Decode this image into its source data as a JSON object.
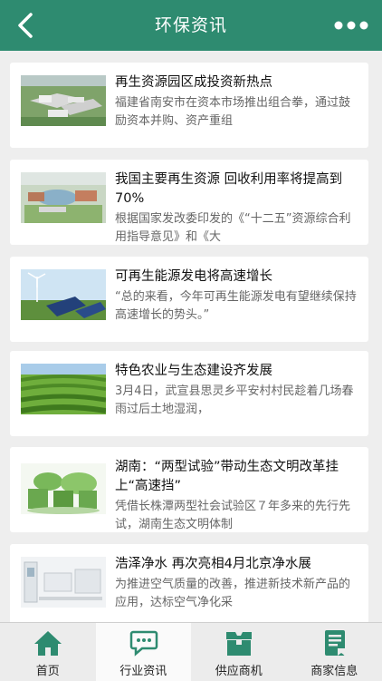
{
  "header": {
    "title": "环保资讯",
    "back_icon": "chevron-left-icon",
    "more_icon": "more-dots-icon",
    "color": "#2e8b70"
  },
  "news": [
    {
      "title": "再生资源园区成投资新热点",
      "desc": "福建省南安市在资本市场推出组合拳，通过鼓励资本并购、资产重组",
      "image": "industrial-park-aerial-image"
    },
    {
      "title": "我国主要再生资源 回收利用率将提高到70%",
      "desc": "根据国家发改委印发的《“十二五”资源综合利用指导意见》和《大",
      "image": "recycling-park-rendering-image"
    },
    {
      "title": "可再生能源发电将高速增长",
      "desc": "“总的来看，今年可再生能源发电有望继续保持高速增长的势头。”",
      "image": "solar-wind-farm-image"
    },
    {
      "title": "特色农业与生态建设齐发展",
      "desc": "3月4日，武宣县思灵乡平安村村民趁着几场春雨过后土地湿润，",
      "image": "tea-plantation-image"
    },
    {
      "title": "湖南：“两型试验”带动生态文明改革挂上“高速挡”",
      "desc": "凭借长株潭两型社会试验区７年多来的先行先试，湖南生态文明体制",
      "image": "ecological-civilization-image"
    },
    {
      "title": "浩泽净水 再次亮相4月北京净水展",
      "desc": "为推进空气质量的改善，推进新技术新产品的应用，达标空气净化采",
      "image": "water-purifier-showroom-image"
    }
  ],
  "tabbar": {
    "items": [
      {
        "label": "首页",
        "icon": "home-icon"
      },
      {
        "label": "行业资讯",
        "icon": "chat-icon"
      },
      {
        "label": "供应商机",
        "icon": "box-icon"
      },
      {
        "label": "商家信息",
        "icon": "document-icon"
      }
    ],
    "active_index": 1
  }
}
